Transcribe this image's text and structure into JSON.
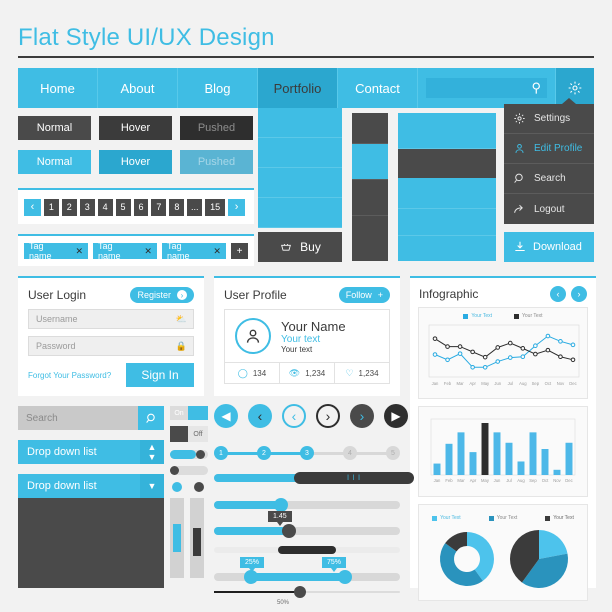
{
  "title": "Flat Style UI/UX Design",
  "colors": {
    "accent": "#3fbde4",
    "accent_dark": "#2ba7cf",
    "dark": "#4a4a4a",
    "bg": "#f2f2f2"
  },
  "nav": {
    "items": [
      {
        "label": "Home",
        "active": false
      },
      {
        "label": "About",
        "active": false
      },
      {
        "label": "Blog",
        "active": false
      },
      {
        "label": "Portfolio",
        "active": true
      },
      {
        "label": "Contact",
        "active": false
      }
    ],
    "search_icon": "search-icon",
    "gear_icon": "gear-icon"
  },
  "menu": {
    "items": [
      {
        "label": "Settings",
        "icon": "gear-icon",
        "highlight": false
      },
      {
        "label": "Edit Profile",
        "icon": "user-icon",
        "highlight": true
      },
      {
        "label": "Search",
        "icon": "search-icon",
        "highlight": false
      },
      {
        "label": "Logout",
        "icon": "logout-arrow-icon",
        "highlight": false
      }
    ],
    "download_label": "Download",
    "download_icon": "download-icon"
  },
  "buttons": {
    "dark_row": [
      "Normal",
      "Hover",
      "Pushed"
    ],
    "blue_row": [
      "Normal",
      "Hover",
      "Pushed"
    ]
  },
  "pagination": {
    "prev": "‹",
    "next": "›",
    "pages": [
      "1",
      "2",
      "3",
      "4",
      "5",
      "6",
      "7",
      "8",
      "...",
      "15"
    ]
  },
  "tags": {
    "items": [
      "Tag name",
      "Tag name",
      "Tag name"
    ],
    "remove_glyph": "✕",
    "add_glyph": "+"
  },
  "portfolio": {
    "buy_label": "Buy",
    "cart_icon": "cart-icon"
  },
  "login": {
    "title": "User Login",
    "register_label": "Register",
    "username_placeholder": "Username",
    "password_placeholder": "Password",
    "forgot_label": "Forgot Your Password?",
    "signin_label": "Sign In",
    "user_icon": "user-icon",
    "lock_icon": "lock-icon"
  },
  "profile": {
    "title": "User Profile",
    "follow_label": "Follow",
    "follow_plus": "+",
    "name": "Your Name",
    "text1": "Your text",
    "text2": "Your text",
    "avatar_icon": "avatar-icon",
    "stats": [
      {
        "icon": "comment-icon",
        "value": "134"
      },
      {
        "icon": "eye-icon",
        "value": "1,234"
      },
      {
        "icon": "heart-icon",
        "value": "1,234"
      }
    ]
  },
  "infographic": {
    "title": "Infographic",
    "prev_glyph": "‹",
    "next_glyph": "›"
  },
  "chart_data": [
    {
      "type": "line",
      "title": "Infographic",
      "x": [
        "Jan",
        "Feb",
        "Mar",
        "Apr",
        "May",
        "Jun",
        "Jul",
        "Aug",
        "Sep",
        "Oct",
        "Nov",
        "Dec"
      ],
      "xlabel": "",
      "ylabel": "",
      "ylim": [
        0,
        100
      ],
      "grid": false,
      "legend": [
        "Your Text",
        "Your Text"
      ],
      "legend_position": "top",
      "series": [
        {
          "name": "Your Text",
          "color": "#29abe2",
          "values": [
            42,
            30,
            44,
            13,
            13,
            26,
            35,
            37,
            62,
            84,
            72,
            64
          ]
        },
        {
          "name": "Your Text",
          "color": "#2e2e2e",
          "values": [
            78,
            60,
            60,
            48,
            36,
            58,
            68,
            56,
            43,
            52,
            37,
            30
          ]
        }
      ]
    },
    {
      "type": "bar",
      "categories": [
        "Jan",
        "Feb",
        "Mar",
        "Apr",
        "May",
        "Jun",
        "Jul",
        "Aug",
        "Sep",
        "Oct",
        "Nov",
        "Dec"
      ],
      "values": [
        22,
        60,
        82,
        44,
        100,
        82,
        62,
        26,
        82,
        50,
        10,
        62
      ],
      "title": "",
      "xlabel": "",
      "ylabel": "",
      "ylim": [
        0,
        100
      ],
      "grid": false,
      "highlight_index": 4,
      "bar_color": "#4db8e8",
      "highlight_color": "#2e2e2e"
    },
    {
      "type": "pie",
      "title": "",
      "variant": "donut",
      "legend": [
        "Your Text",
        "Your Text",
        "Your Text"
      ],
      "labels": [
        "Your Text",
        "Your Text",
        "Your Text"
      ],
      "values": [
        40,
        45,
        15
      ],
      "colors": [
        "#4dc3ec",
        "#2a93bd",
        "#3b3b3b"
      ]
    },
    {
      "type": "pie",
      "title": "",
      "variant": "pie",
      "labels": [
        "Your Text",
        "Your Text",
        "Your Text"
      ],
      "values": [
        22,
        38,
        40
      ],
      "colors": [
        "#4dc3ec",
        "#2a93bd",
        "#3b3b3b"
      ]
    }
  ],
  "controls": {
    "search_placeholder": "Search",
    "search_icon": "search-icon",
    "dropdown_1": "Drop down list",
    "dropdown_2": "Drop down list",
    "toggle_on_label": "On",
    "toggle_off_label": "Off"
  },
  "steps": {
    "items": [
      "1",
      "2",
      "3",
      "4",
      "5"
    ],
    "active_count": 3
  },
  "sliders": {
    "volume_tip": "l l l",
    "value_tip": "1.45",
    "range_low": "25%",
    "range_high": "75%",
    "bottom_label": "50%"
  },
  "arrows": {
    "glyphs": [
      "◀",
      "‹",
      "‹",
      "›",
      "›",
      "▶"
    ]
  }
}
